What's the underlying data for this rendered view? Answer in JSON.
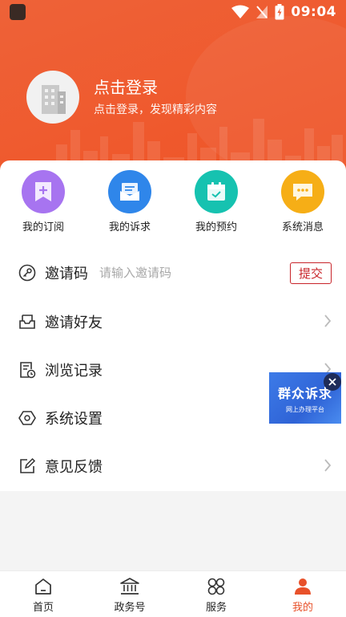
{
  "status_bar": {
    "time": "09:04"
  },
  "profile": {
    "title": "点击登录",
    "subtitle": "点击登录，发现精彩内容"
  },
  "quick_actions": [
    {
      "label": "我的订阅",
      "icon": "bookmark-add-icon",
      "color": "#a774f0"
    },
    {
      "label": "我的诉求",
      "icon": "mail-box-icon",
      "color": "#2f86ea"
    },
    {
      "label": "我的预约",
      "icon": "calendar-icon",
      "color": "#16c2b0"
    },
    {
      "label": "系统消息",
      "icon": "message-icon",
      "color": "#f6ae16"
    }
  ],
  "invite": {
    "label": "邀请码",
    "placeholder": "请输入邀请码",
    "submit_label": "提交"
  },
  "menu": [
    {
      "label": "邀请好友",
      "icon": "inbox-icon"
    },
    {
      "label": "浏览记录",
      "icon": "history-icon"
    },
    {
      "label": "系统设置",
      "icon": "settings-icon"
    },
    {
      "label": "意见反馈",
      "icon": "feedback-edit-icon"
    }
  ],
  "float_banner": {
    "title": "群众诉求",
    "subtitle": "网上办理平台"
  },
  "tabs": [
    {
      "label": "首页",
      "icon": "home-icon"
    },
    {
      "label": "政务号",
      "icon": "government-icon"
    },
    {
      "label": "服务",
      "icon": "services-grid-icon"
    },
    {
      "label": "我的",
      "icon": "user-icon",
      "active": true
    }
  ],
  "colors": {
    "accent": "#e8512a",
    "header": "#ef5a2e",
    "submit": "#c8242a"
  }
}
